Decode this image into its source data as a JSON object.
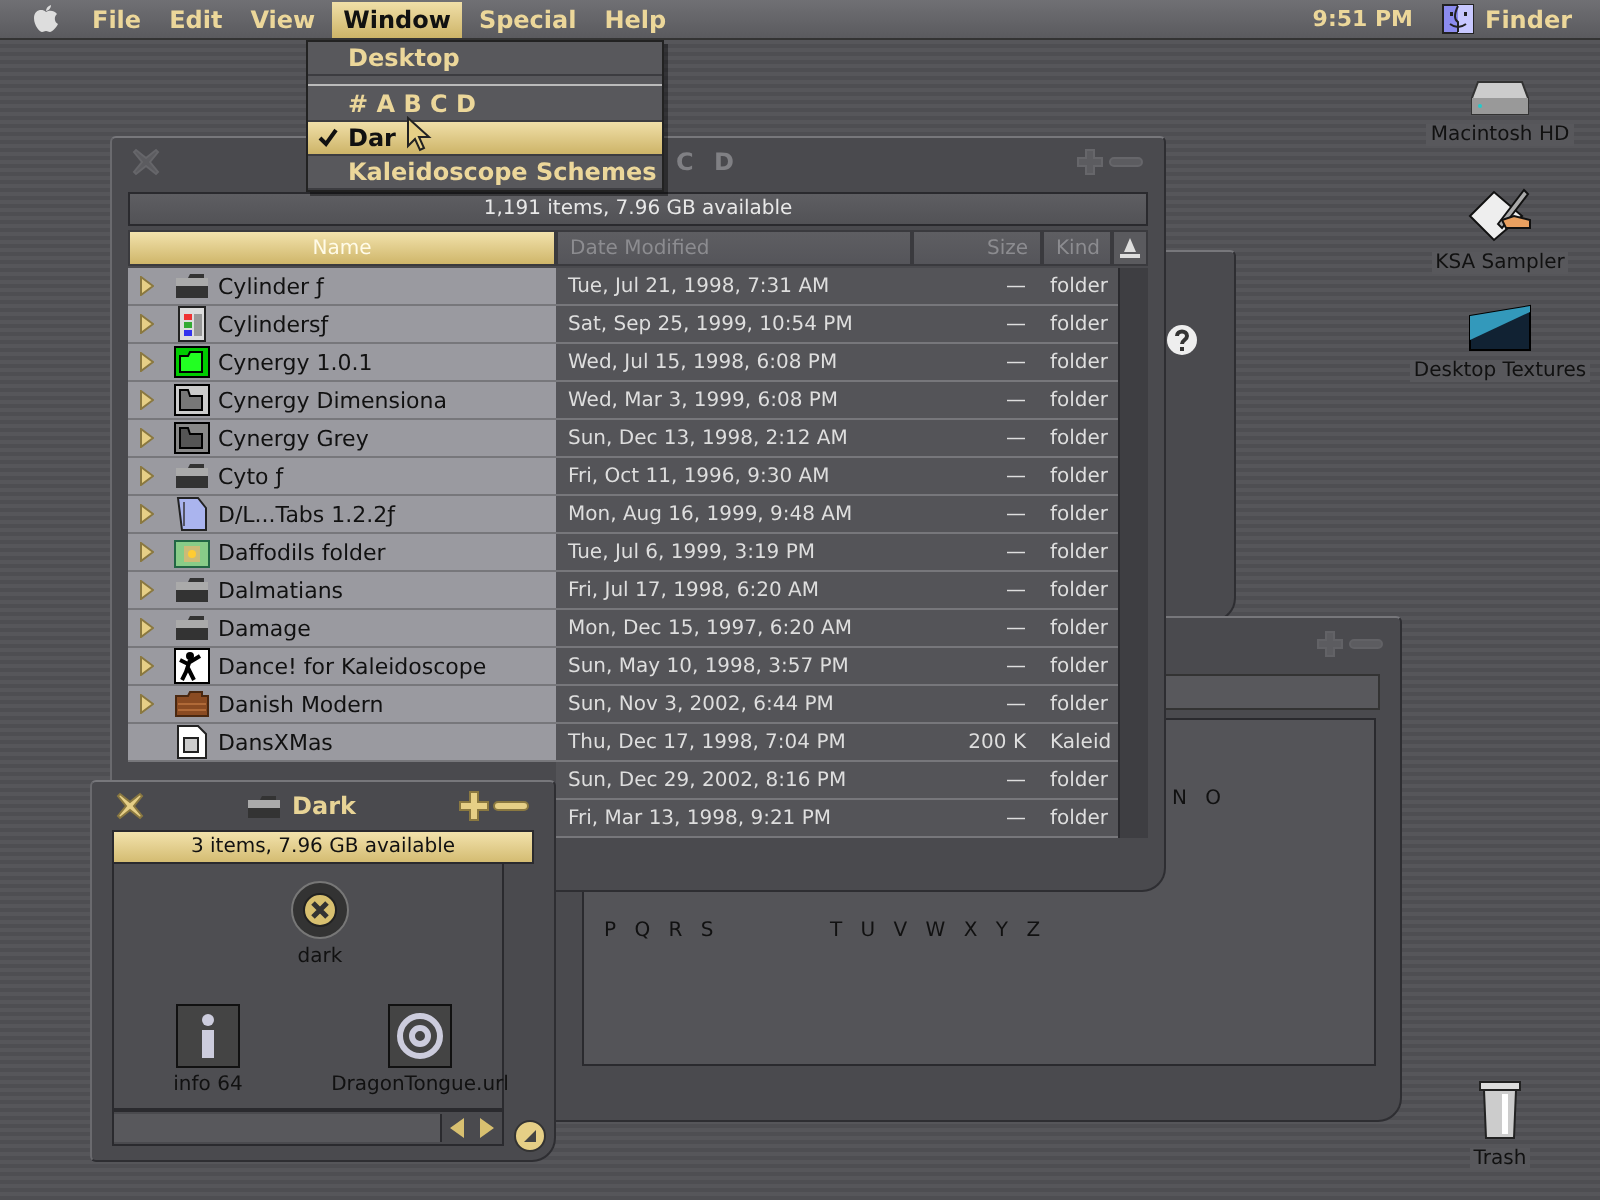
{
  "menu_bar": {
    "menus": [
      {
        "label": "File",
        "selected": false
      },
      {
        "label": "Edit",
        "selected": false
      },
      {
        "label": "View",
        "selected": false
      },
      {
        "label": "Window",
        "selected": true
      },
      {
        "label": "Special",
        "selected": false
      },
      {
        "label": "Help",
        "selected": false
      }
    ],
    "clock": "9:51 PM",
    "app": "Finder"
  },
  "window_menu": {
    "items": [
      {
        "kind": "item",
        "label": "Desktop",
        "checked": false,
        "selected": false
      },
      {
        "kind": "separator"
      },
      {
        "kind": "item",
        "label": "# A B C D",
        "checked": false,
        "selected": false
      },
      {
        "kind": "item",
        "label": "Dar",
        "checked": true,
        "selected": true
      },
      {
        "kind": "item",
        "label": "Kaleidoscope Schemes",
        "checked": false,
        "selected": false
      }
    ]
  },
  "list_window": {
    "title": "C D",
    "info": "1,191 items, 7.96 GB available",
    "columns": [
      {
        "label": "Name",
        "selected": true
      },
      {
        "label": "Date Modified",
        "selected": false
      },
      {
        "label": "Size",
        "selected": false
      },
      {
        "label": "Kind",
        "selected": false
      }
    ],
    "rows": [
      {
        "name": "Cylinder ƒ",
        "kind": "dark-folder",
        "expandable": true,
        "date": "Tue, Jul 21, 1998, 7:31 AM",
        "size": "—",
        "file_kind": "folder"
      },
      {
        "name": "Cylindersƒ",
        "kind": "theme",
        "expandable": true,
        "date": "Sat, Sep 25, 1999, 10:54 PM",
        "size": "—",
        "file_kind": "folder"
      },
      {
        "name": "Cynergy 1.0.1",
        "kind": "green-folder",
        "expandable": true,
        "date": "Wed, Jul 15, 1998, 6:08 PM",
        "size": "—",
        "file_kind": "folder"
      },
      {
        "name": "Cynergy Dimensiona",
        "kind": "outline-folder",
        "expandable": true,
        "date": "Wed, Mar 3, 1999, 6:08 PM",
        "size": "—",
        "file_kind": "folder"
      },
      {
        "name": "Cynergy Grey",
        "kind": "grey-folder",
        "expandable": true,
        "date": "Sun, Dec 13, 1998, 2:12 AM",
        "size": "—",
        "file_kind": "folder"
      },
      {
        "name": "Cyto ƒ",
        "kind": "dark-folder",
        "expandable": true,
        "date": "Fri, Oct 11, 1996, 9:30 AM",
        "size": "—",
        "file_kind": "folder"
      },
      {
        "name": "D/L...Tabs 1.2.2ƒ",
        "kind": "doc",
        "expandable": true,
        "date": "Mon, Aug 16, 1999, 9:48 AM",
        "size": "—",
        "file_kind": "folder"
      },
      {
        "name": "Daffodils folder",
        "kind": "picture-folder",
        "expandable": true,
        "date": "Tue, Jul 6, 1999, 3:19 PM",
        "size": "—",
        "file_kind": "folder"
      },
      {
        "name": "Dalmatians",
        "kind": "dark-folder",
        "expandable": true,
        "date": "Fri, Jul 17, 1998, 6:20 AM",
        "size": "—",
        "file_kind": "folder"
      },
      {
        "name": "Damage",
        "kind": "dark-folder",
        "expandable": true,
        "date": "Mon, Dec 15, 1997, 6:20 AM",
        "size": "—",
        "file_kind": "folder"
      },
      {
        "name": "Dance! for Kaleidoscope",
        "kind": "dance",
        "expandable": true,
        "date": "Sun, May 10, 1998, 3:57 PM",
        "size": "—",
        "file_kind": "folder"
      },
      {
        "name": "Danish Modern",
        "kind": "brown-folder",
        "expandable": true,
        "date": "Sun, Nov 3, 2002, 6:44 PM",
        "size": "—",
        "file_kind": "folder"
      },
      {
        "name": "DansXMas",
        "kind": "file",
        "expandable": false,
        "date": "Thu, Dec 17, 1998, 7:04 PM",
        "size": "200 K",
        "file_kind": "Kaleid"
      },
      {
        "date": "Sun, Dec 29, 2002, 8:16 PM",
        "size": "—",
        "file_kind": "folder"
      },
      {
        "date": "Fri, Mar 13, 1998, 9:21 PM",
        "size": "—",
        "file_kind": "folder"
      }
    ]
  },
  "back_window": {
    "labels": [
      "N O",
      "P Q R S",
      "T U V W X Y Z"
    ]
  },
  "dark_window": {
    "title": "Dark",
    "info": "3 items, 7.96 GB available",
    "icons": [
      {
        "label": "dark",
        "kind": "button"
      },
      {
        "label": "info 64",
        "kind": "info"
      },
      {
        "label": "DragonTongue.url",
        "kind": "url"
      }
    ]
  },
  "desktop_icons": [
    {
      "label": "Macintosh HD",
      "kind": "disk"
    },
    {
      "label": "KSA Sampler",
      "kind": "sampler"
    },
    {
      "label": "Desktop Textures",
      "kind": "texture"
    },
    {
      "label": "Trash",
      "kind": "trash"
    }
  ]
}
